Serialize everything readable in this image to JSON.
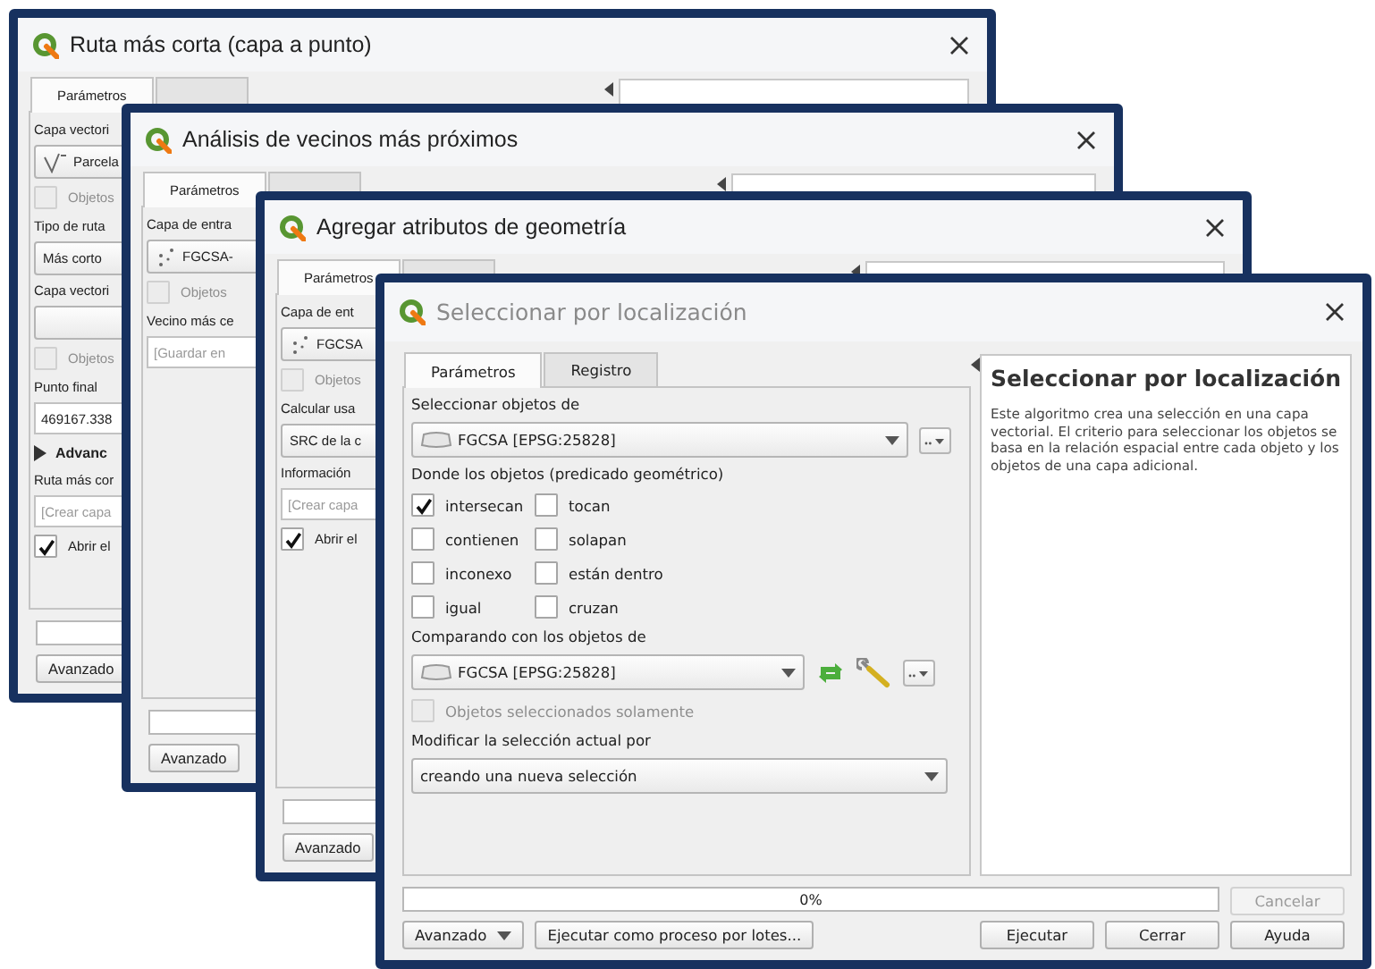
{
  "windows": [
    {
      "title": "Ruta más corta (capa a punto)",
      "active": true,
      "tabs": [
        {
          "label": "Parámetros",
          "selected": true
        },
        {
          "selected": false
        }
      ],
      "params": [
        {
          "kind": "label",
          "text": "Capa vectori"
        },
        {
          "kind": "combo",
          "value": "Parcela"
        },
        {
          "kind": "checkbox",
          "label": "Objetos",
          "checked": false,
          "disabled": true
        },
        {
          "kind": "label",
          "text": "Tipo de ruta"
        },
        {
          "kind": "combo",
          "value": "Más corto"
        },
        {
          "kind": "label",
          "text": "Capa vectori"
        },
        {
          "kind": "combo"
        },
        {
          "kind": "checkbox",
          "label": "Objetos",
          "checked": false,
          "disabled": true
        },
        {
          "kind": "label",
          "text": "Punto final"
        },
        {
          "kind": "field",
          "value": "469167.338"
        },
        {
          "kind": "expander",
          "label": "Advanc",
          "expanded": false
        },
        {
          "kind": "label",
          "text": "Ruta más cor"
        },
        {
          "kind": "field",
          "placeholder": "[Crear capa"
        },
        {
          "kind": "checkbox",
          "label": "Abrir el",
          "checked": true,
          "disabled": false
        }
      ],
      "progress": {
        "level": 0
      },
      "buttons": [
        {
          "label": "Avanzado",
          "kind": "plain"
        }
      ]
    },
    {
      "title": "Análisis de vecinos más próximos",
      "active": true,
      "tabs": [
        {
          "label": "Parámetros",
          "selected": true
        },
        {
          "selected": false
        }
      ],
      "params": [
        {
          "kind": "label",
          "text": "Capa de entra"
        },
        {
          "kind": "combo",
          "value": "FGCSA-"
        },
        {
          "kind": "checkbox",
          "label": "Objetos",
          "checked": false,
          "disabled": true
        },
        {
          "kind": "label",
          "text": "Vecino más ce"
        },
        {
          "kind": "field",
          "placeholder": "[Guardar en"
        }
      ],
      "progress": {
        "level": 0
      },
      "buttons": [
        {
          "label": "Avanzado",
          "kind": "plain"
        }
      ]
    },
    {
      "title": "Agregar atributos de geometría",
      "active": true,
      "tabs": [
        {
          "label": "Parámetros",
          "selected": true
        },
        {
          "selected": false
        }
      ],
      "params": [
        {
          "kind": "label",
          "text": "Capa de ent"
        },
        {
          "kind": "combo",
          "value": "FGCSA"
        },
        {
          "kind": "checkbox",
          "label": "Objetos",
          "checked": false,
          "disabled": true
        },
        {
          "kind": "label",
          "text": "Calcular usa"
        },
        {
          "kind": "combo",
          "value": "SRC de la c"
        },
        {
          "kind": "label",
          "text": "Información"
        },
        {
          "kind": "field",
          "placeholder": "[Crear capa"
        },
        {
          "kind": "checkbox",
          "label": "Abrir el",
          "checked": true,
          "disabled": false
        }
      ],
      "progress": {
        "level": 0
      },
      "buttons": [
        {
          "label": "Avanzado",
          "kind": "plain"
        }
      ]
    },
    {
      "title": "Seleccionar por localización",
      "active": false,
      "tabs": [
        {
          "label": "Parámetros",
          "selected": true
        },
        {
          "label": "Registro",
          "selected": false
        }
      ],
      "params": [
        {
          "kind": "label",
          "text": "Seleccionar objetos de"
        },
        {
          "kind": "combo",
          "value": "FGCSA [EPSG:25828]"
        },
        {
          "kind": "label",
          "text": "Donde los objetos (predicado geométrico)"
        },
        {
          "kind": "checkgrid",
          "items": [
            {
              "label": "intersecan",
              "checked": true
            },
            {
              "label": "tocan",
              "checked": false
            },
            {
              "label": "contienen",
              "checked": false
            },
            {
              "label": "solapan",
              "checked": false
            },
            {
              "label": "inconexo",
              "checked": false
            },
            {
              "label": "están dentro",
              "checked": false
            },
            {
              "label": "igual",
              "checked": false
            },
            {
              "label": "cruzan",
              "checked": false
            }
          ]
        },
        {
          "kind": "label",
          "text": "Comparando con los objetos de"
        },
        {
          "kind": "combo",
          "value": "FGCSA [EPSG:25828]"
        },
        {
          "kind": "checkbox",
          "label": "Objetos seleccionados solamente",
          "checked": false,
          "disabled": true
        },
        {
          "kind": "label",
          "text": "Modificar la selección actual por"
        },
        {
          "kind": "combo",
          "value": "creando una nueva selección"
        }
      ],
      "help": {
        "title": "Seleccionar por localización",
        "text": "Este algoritmo crea una selección en una capa vectorial. El criterio para seleccionar los objetos se basa en la relación espacial entre cada objeto y los objetos de una capa adicional."
      },
      "progress": {
        "level": 0,
        "text": "0%"
      },
      "cancel": {
        "label": "Cancelar",
        "disabled": true
      },
      "buttons": [
        {
          "label": "Avanzado",
          "kind": "menu"
        },
        {
          "label": "Ejecutar como proceso por lotes...",
          "kind": "plain"
        },
        {
          "label": "Ejecutar",
          "kind": "plain"
        },
        {
          "label": "Cerrar",
          "kind": "plain"
        },
        {
          "label": "Ayuda",
          "kind": "plain"
        }
      ]
    }
  ]
}
